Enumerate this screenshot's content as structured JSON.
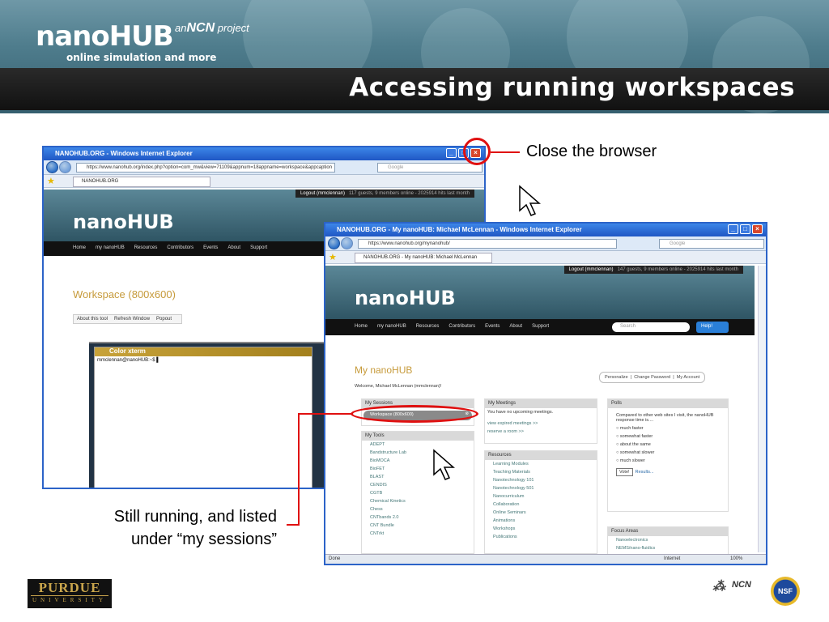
{
  "slide": {
    "title": "Accessing running workspaces",
    "logo": {
      "main": "nanoHUB",
      "tagline": "online simulation and more",
      "ncn_prefix": "an",
      "ncn_name": "NCN",
      "ncn_suffix": "project"
    },
    "annotations": {
      "close": "Close the browser",
      "running_line1": "Still running, and listed",
      "running_line2": "under “my sessions”"
    },
    "footer": {
      "purdue_main": "PURDUE",
      "purdue_sub": "UNIVERSITY",
      "ncn_logo": "NCN",
      "nsf_logo": "NSF"
    },
    "accent_color": "#e01010"
  },
  "back_window": {
    "title": "NANOHUB.ORG - Windows Internet Explorer",
    "url": "https://www.nanohub.org/index.php?option=com_mw&view=71109&appnum=18appname=workspace&appcaption",
    "search_placeholder": "Google",
    "tab": "NANOHUB.ORG",
    "logout": "Logout (mmclennan)",
    "online": "117 guests, 9 members online - 2025914 hits last month",
    "nav": [
      "Home",
      "my nanoHUB",
      "Resources",
      "Contributors",
      "Events",
      "About",
      "Support"
    ],
    "workspace_title": "Workspace (800x600)",
    "toolbar": [
      "About this tool",
      "Refresh Window",
      "Popout"
    ],
    "xterm_title": "Color xterm",
    "xterm_prompt": "mmclennan@nanoHUB:~$ ▌"
  },
  "front_window": {
    "title": "NANOHUB.ORG - My nanoHUB: Michael McLennan - Windows Internet Explorer",
    "url": "https://www.nanohub.org/mynanohub/",
    "search_placeholder": "Google",
    "tab": "NANOHUB.ORG - My nanoHUB: Michael McLennan",
    "logout": "Logout (mmclennan)",
    "online": "147 guests, 9 members online - 2025914 hits last month",
    "nav": [
      "Home",
      "my nanoHUB",
      "Resources",
      "Contributors",
      "Events",
      "About",
      "Support"
    ],
    "search_field": "Search",
    "help": "Help!",
    "page_title": "My nanoHUB",
    "welcome": "Welcome, Michael McLennan (mmclennan)!",
    "account_buttons": [
      "Personalize",
      "Change Password",
      "My Account"
    ],
    "sessions_header": "My Sessions",
    "session_item": "Workspace (800x600)",
    "tools_header": "My Tools",
    "tools": [
      "ADEPT",
      "Bandstructure Lab",
      "BioMOCA",
      "BioFET",
      "BLAST",
      "CENDIS",
      "CGTB",
      "Chemical Kinetics",
      "Chess",
      "CNTbands 2.0",
      "CNT Bundle",
      "CNTrkt"
    ],
    "meetings_header": "My Meetings",
    "meetings_text": "You have no upcoming meetings.",
    "meetings_links": [
      "view expired meetings >>",
      "reserve a room >>"
    ],
    "resources_header": "Resources",
    "resources": [
      "Learning Modules",
      "Teaching Materials",
      "Nanotechnology 101",
      "Nanotechnology 501",
      "Nanocurriculum",
      "Collaboration",
      "Online Seminars",
      "Animations",
      "Workshops",
      "Publications"
    ],
    "polls_header": "Polls",
    "poll_question": "Compared to other web sites I visit, the nanoHUB response time is....",
    "poll_options": [
      "much faster",
      "somewhat faster",
      "about the same",
      "somewhat slower",
      "much slower"
    ],
    "vote": "Vote!",
    "results": "Results...",
    "focus_header": "Focus Areas",
    "focus_items": [
      "Nanoelectronics",
      "NEMS/nano-fluidics"
    ],
    "status": "Done",
    "zone": "Internet",
    "zoom": "100%"
  }
}
